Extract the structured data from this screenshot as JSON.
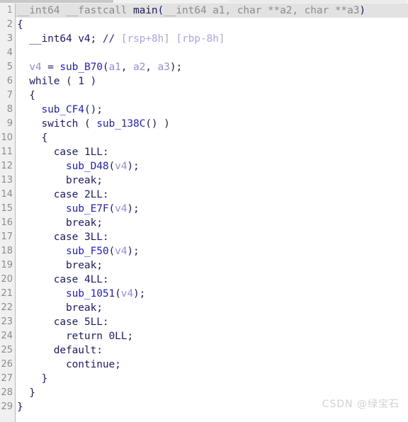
{
  "window": {
    "kind": "decompiler-pseudocode-view",
    "background_color": "#ffffff",
    "gutter_color": "#f0f0f0",
    "highlight_color": "#e2e2e2"
  },
  "colors": {
    "plain": "#1b1b6e",
    "type": "#8c8c8c",
    "function": "#2222cc",
    "variable": "#8f8fe0",
    "comment": "#2222cc",
    "comment_text": "#a8a8e8"
  },
  "watermark": {
    "text": "CSDN @绿宝石"
  },
  "code": {
    "total_lines": 29,
    "highlighted_line": 1,
    "line_numbers": [
      "1",
      "2",
      "3",
      "4",
      "5",
      "6",
      "7",
      "8",
      "9",
      "10",
      "11",
      "12",
      "13",
      "14",
      "15",
      "16",
      "17",
      "18",
      "19",
      "20",
      "21",
      "22",
      "23",
      "24",
      "25",
      "26",
      "27",
      "28",
      "29"
    ],
    "lines": [
      {
        "n": "1",
        "text": "__int64 __fastcall main(__int64 a1, char **a2, char **a3)"
      },
      {
        "n": "2",
        "text": "{"
      },
      {
        "n": "3",
        "text": "  __int64 v4; // [rsp+8h] [rbp-8h]"
      },
      {
        "n": "4",
        "text": ""
      },
      {
        "n": "5",
        "text": "  v4 = sub_B70(a1, a2, a3);"
      },
      {
        "n": "6",
        "text": "  while ( 1 )"
      },
      {
        "n": "7",
        "text": "  {"
      },
      {
        "n": "8",
        "text": "    sub_CF4();"
      },
      {
        "n": "9",
        "text": "    switch ( sub_138C() )"
      },
      {
        "n": "10",
        "text": "    {"
      },
      {
        "n": "11",
        "text": "      case 1LL:"
      },
      {
        "n": "12",
        "text": "        sub_D48(v4);"
      },
      {
        "n": "13",
        "text": "        break;"
      },
      {
        "n": "14",
        "text": "      case 2LL:"
      },
      {
        "n": "15",
        "text": "        sub_E7F(v4);"
      },
      {
        "n": "16",
        "text": "        break;"
      },
      {
        "n": "17",
        "text": "      case 3LL:"
      },
      {
        "n": "18",
        "text": "        sub_F50(v4);"
      },
      {
        "n": "19",
        "text": "        break;"
      },
      {
        "n": "20",
        "text": "      case 4LL:"
      },
      {
        "n": "21",
        "text": "        sub_1051(v4);"
      },
      {
        "n": "22",
        "text": "        break;"
      },
      {
        "n": "23",
        "text": "      case 5LL:"
      },
      {
        "n": "24",
        "text": "        return 0LL;"
      },
      {
        "n": "25",
        "text": "      default:"
      },
      {
        "n": "26",
        "text": "        continue;"
      },
      {
        "n": "27",
        "text": "    }"
      },
      {
        "n": "28",
        "text": "  }"
      },
      {
        "n": "29",
        "text": "}"
      }
    ],
    "tokens": [
      [
        {
          "c": "type",
          "s": "__int64 __fastcall "
        },
        {
          "c": "plain",
          "s": "main"
        },
        {
          "c": "punct",
          "s": "("
        },
        {
          "c": "type",
          "s": "__int64 a1"
        },
        {
          "c": "type",
          "s": ", "
        },
        {
          "c": "type",
          "s": "char **a2"
        },
        {
          "c": "type",
          "s": ", "
        },
        {
          "c": "type",
          "s": "char **a3"
        },
        {
          "c": "punct",
          "s": ")"
        }
      ],
      [
        {
          "c": "punct",
          "s": "{"
        }
      ],
      [
        {
          "c": "plain",
          "s": "  __int64 v4; "
        },
        {
          "c": "comment",
          "s": "// "
        },
        {
          "c": "commtxt",
          "s": "[rsp+8h] [rbp-8h]"
        }
      ],
      [
        {
          "c": "plain",
          "s": ""
        }
      ],
      [
        {
          "c": "plain",
          "s": "  "
        },
        {
          "c": "var",
          "s": "v4"
        },
        {
          "c": "plain",
          "s": " = "
        },
        {
          "c": "func",
          "s": "sub_B70"
        },
        {
          "c": "punct",
          "s": "("
        },
        {
          "c": "var",
          "s": "a1"
        },
        {
          "c": "plain",
          "s": ", "
        },
        {
          "c": "var",
          "s": "a2"
        },
        {
          "c": "plain",
          "s": ", "
        },
        {
          "c": "var",
          "s": "a3"
        },
        {
          "c": "punct",
          "s": ");"
        }
      ],
      [
        {
          "c": "kw",
          "s": "  while ( 1 )"
        }
      ],
      [
        {
          "c": "punct",
          "s": "  {"
        }
      ],
      [
        {
          "c": "plain",
          "s": "    "
        },
        {
          "c": "func",
          "s": "sub_CF4"
        },
        {
          "c": "punct",
          "s": "();"
        }
      ],
      [
        {
          "c": "plain",
          "s": "    "
        },
        {
          "c": "kw",
          "s": "switch"
        },
        {
          "c": "plain",
          "s": " ( "
        },
        {
          "c": "func",
          "s": "sub_138C"
        },
        {
          "c": "punct",
          "s": "()"
        },
        {
          "c": "plain",
          "s": " )"
        }
      ],
      [
        {
          "c": "punct",
          "s": "    {"
        }
      ],
      [
        {
          "c": "plain",
          "s": "      "
        },
        {
          "c": "kw",
          "s": "case"
        },
        {
          "c": "plain",
          "s": " 1LL:"
        }
      ],
      [
        {
          "c": "plain",
          "s": "        "
        },
        {
          "c": "func",
          "s": "sub_D48"
        },
        {
          "c": "punct",
          "s": "("
        },
        {
          "c": "var",
          "s": "v4"
        },
        {
          "c": "punct",
          "s": ");"
        }
      ],
      [
        {
          "c": "plain",
          "s": "        "
        },
        {
          "c": "kw",
          "s": "break;"
        }
      ],
      [
        {
          "c": "plain",
          "s": "      "
        },
        {
          "c": "kw",
          "s": "case"
        },
        {
          "c": "plain",
          "s": " 2LL:"
        }
      ],
      [
        {
          "c": "plain",
          "s": "        "
        },
        {
          "c": "func",
          "s": "sub_E7F"
        },
        {
          "c": "punct",
          "s": "("
        },
        {
          "c": "var",
          "s": "v4"
        },
        {
          "c": "punct",
          "s": ");"
        }
      ],
      [
        {
          "c": "plain",
          "s": "        "
        },
        {
          "c": "kw",
          "s": "break;"
        }
      ],
      [
        {
          "c": "plain",
          "s": "      "
        },
        {
          "c": "kw",
          "s": "case"
        },
        {
          "c": "plain",
          "s": " 3LL:"
        }
      ],
      [
        {
          "c": "plain",
          "s": "        "
        },
        {
          "c": "func",
          "s": "sub_F50"
        },
        {
          "c": "punct",
          "s": "("
        },
        {
          "c": "var",
          "s": "v4"
        },
        {
          "c": "punct",
          "s": ");"
        }
      ],
      [
        {
          "c": "plain",
          "s": "        "
        },
        {
          "c": "kw",
          "s": "break;"
        }
      ],
      [
        {
          "c": "plain",
          "s": "      "
        },
        {
          "c": "kw",
          "s": "case"
        },
        {
          "c": "plain",
          "s": " 4LL:"
        }
      ],
      [
        {
          "c": "plain",
          "s": "        "
        },
        {
          "c": "func",
          "s": "sub_1051"
        },
        {
          "c": "punct",
          "s": "("
        },
        {
          "c": "var",
          "s": "v4"
        },
        {
          "c": "punct",
          "s": ");"
        }
      ],
      [
        {
          "c": "plain",
          "s": "        "
        },
        {
          "c": "kw",
          "s": "break;"
        }
      ],
      [
        {
          "c": "plain",
          "s": "      "
        },
        {
          "c": "kw",
          "s": "case"
        },
        {
          "c": "plain",
          "s": " 5LL:"
        }
      ],
      [
        {
          "c": "plain",
          "s": "        "
        },
        {
          "c": "kw",
          "s": "return"
        },
        {
          "c": "plain",
          "s": " 0LL;"
        }
      ],
      [
        {
          "c": "plain",
          "s": "      "
        },
        {
          "c": "kw",
          "s": "default:"
        }
      ],
      [
        {
          "c": "plain",
          "s": "        "
        },
        {
          "c": "kw",
          "s": "continue;"
        }
      ],
      [
        {
          "c": "punct",
          "s": "    }"
        }
      ],
      [
        {
          "c": "punct",
          "s": "  }"
        }
      ],
      [
        {
          "c": "punct",
          "s": "}"
        }
      ]
    ]
  }
}
